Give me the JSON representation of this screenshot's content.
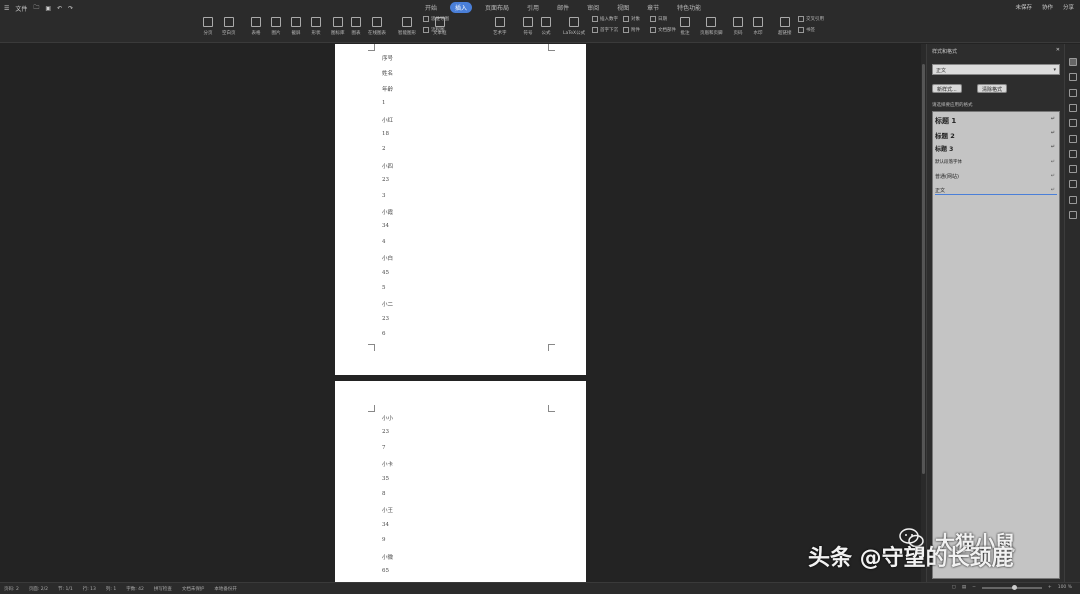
{
  "titlebar": {
    "file_label": "文件",
    "tabs": [
      "开始",
      "插入",
      "页面布局",
      "引用",
      "邮件",
      "审阅",
      "视图",
      "章节",
      "特色功能"
    ],
    "active_tab": "插入",
    "right": [
      "未保存",
      "协作",
      "分享"
    ]
  },
  "ribbon": {
    "buttons": [
      {
        "label": "分页"
      },
      {
        "label": "空白页"
      },
      {
        "label": "表格"
      },
      {
        "label": "图片"
      },
      {
        "label": "截屏"
      },
      {
        "label": "形状"
      },
      {
        "label": "图标库"
      },
      {
        "label": "图表"
      },
      {
        "label": "在线图表"
      },
      {
        "label": "智能图形"
      },
      {
        "label": "文本框"
      },
      {
        "label": "艺术字"
      },
      {
        "label": "符号"
      },
      {
        "label": "公式"
      },
      {
        "label": "LaTeX公式"
      },
      {
        "label": "批注"
      },
      {
        "label": "页眉和页脚"
      },
      {
        "label": "页码"
      },
      {
        "label": "水印"
      },
      {
        "label": "超链接"
      }
    ],
    "small": [
      "思维导图",
      "流程图",
      "插入数字",
      "对象",
      "首字下沉",
      "附件",
      "日期",
      "文档部件",
      "交叉引用",
      "书签"
    ]
  },
  "document": {
    "page1_lines": [
      "序号",
      "姓名",
      "年龄",
      "1",
      "小红",
      "18",
      "2",
      "小四",
      "23",
      "3",
      "小霞",
      "34",
      "4",
      "小白",
      "45",
      "5",
      "小二",
      "23",
      "6"
    ],
    "page2_lines": [
      "小小",
      "23",
      "7",
      "小卡",
      "35",
      "8",
      "小王",
      "34",
      "9",
      "小微",
      "65"
    ]
  },
  "panel": {
    "title": "样式和格式",
    "current_style": "正文",
    "new_style_btn": "新样式...",
    "clear_btn": "清除格式",
    "sub_label": "请选择要应用的格式",
    "styles": [
      {
        "name": "标题 1",
        "size": 7
      },
      {
        "name": "标题 2",
        "size": 6.5
      },
      {
        "name": "标题 3",
        "size": 6
      },
      {
        "name": "默认段落字体",
        "size": 4.5
      },
      {
        "name": "普通(网站)",
        "size": 5
      },
      {
        "name": "正文",
        "size": 5
      }
    ]
  },
  "status": {
    "left": [
      "页码: 2",
      "页面: 2/2",
      "节: 1/1",
      "行: 13",
      "列: 1",
      "字数: 42",
      "拼写检查",
      "文档未保护",
      "本地备份开"
    ],
    "zoom": "100 %"
  },
  "watermark": {
    "line1": "头条 @守望的长颈鹿",
    "line2": "大猫小鼠"
  }
}
